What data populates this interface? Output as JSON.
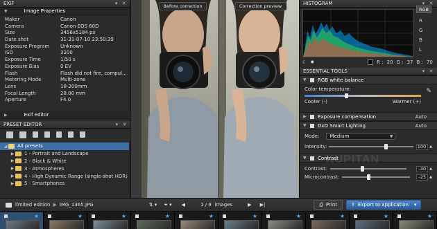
{
  "exif_panel": {
    "title": "EXIF",
    "section_title": "Image Properties",
    "rows": [
      {
        "key": "Maker",
        "value": "Canon"
      },
      {
        "key": "Camera",
        "value": "Canon EOS 60D"
      },
      {
        "key": "Size",
        "value": "3456x5184 px"
      },
      {
        "key": "Date shot",
        "value": "31-31-07-10 23:50:39"
      },
      {
        "key": "Exposure Program",
        "value": "Unknown"
      },
      {
        "key": "ISO",
        "value": "3200"
      },
      {
        "key": "Exposure Time",
        "value": "1/50 s"
      },
      {
        "key": "Exposure Bias",
        "value": "0 EV"
      },
      {
        "key": "Flash",
        "value": "Flash did not fire, compul..."
      },
      {
        "key": "Metering Mode",
        "value": "Multi-zone"
      },
      {
        "key": "Lens",
        "value": "18-200mm"
      },
      {
        "key": "Focal Length",
        "value": "28.00 mm"
      },
      {
        "key": "Aperture",
        "value": "F4.0"
      }
    ],
    "exif_editor_label": "Exif editor"
  },
  "preset_editor": {
    "title": "PRESET EDITOR",
    "items": [
      {
        "label": "All presets",
        "selected": true
      },
      {
        "label": "1 - Portrait and Landscape"
      },
      {
        "label": "2 - Black & White"
      },
      {
        "label": "3 - Atmospheres"
      },
      {
        "label": "4 - High Dynamic Range (single-shot HDR)"
      },
      {
        "label": "5 - Smartphones"
      }
    ]
  },
  "viewer": {
    "before_label": "Before correction",
    "after_label": "Correction preview"
  },
  "histogram": {
    "title": "HISTOGRAM",
    "mode_button": "RGB",
    "channels": [
      "R",
      "G",
      "B",
      "L"
    ],
    "readout": {
      "r_label": "R :",
      "r": "20",
      "g_label": "G :",
      "g": "37",
      "b_label": "B :",
      "b": "70"
    }
  },
  "essential_tools": {
    "title": "ESSENTIAL TOOLS",
    "white_balance": {
      "title": "RGB white balance",
      "color_temp_label": "Color temperature:",
      "cooler_label": "Cooler (-)",
      "warmer_label": "Warmer (+)"
    },
    "exposure": {
      "title": "Exposure compensation",
      "auto": "Auto"
    },
    "smart_lighting": {
      "title": "DxO Smart Lighting",
      "auto": "Auto",
      "mode_label": "Mode:",
      "mode_value": "Medium",
      "intensity_label": "Intensity:",
      "intensity_value": "100"
    },
    "contrast": {
      "title": "Contrast",
      "contrast_label": "Contrast:",
      "contrast_value": "-40",
      "microcontrast_label": "Microcontrast:",
      "microcontrast_value": "-25"
    }
  },
  "bottom_bar": {
    "folder": "limited edition",
    "file": "IMG_1365.JPG",
    "counter": "1 / 9",
    "counter_unit": "images",
    "print_label": "Print",
    "export_label": "Export to application"
  },
  "colors": {
    "accent": "#3a6ea5",
    "star": "#59a8f0"
  }
}
